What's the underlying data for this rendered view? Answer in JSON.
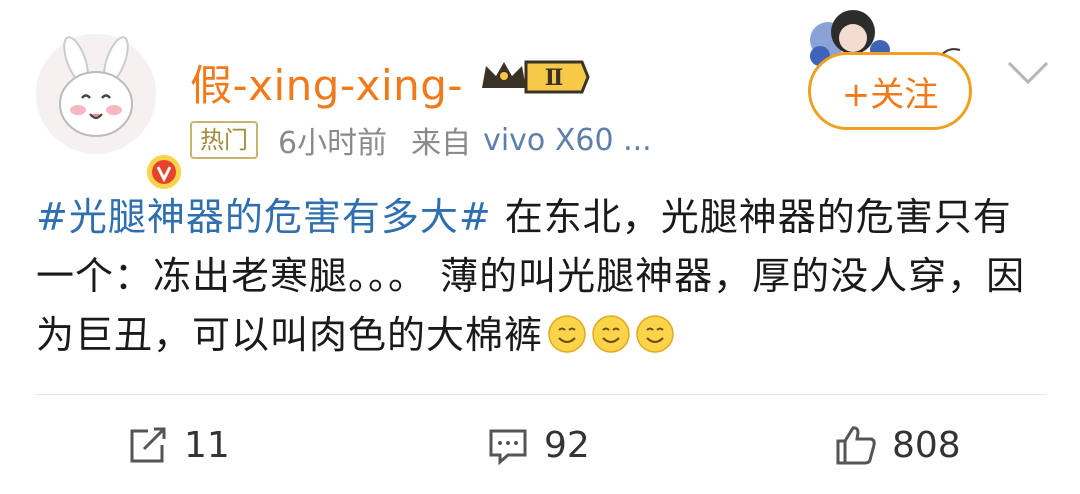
{
  "user": {
    "name": "假-xing-xing-",
    "rank_label": "Ⅱ",
    "follow_label": "+关注",
    "avatar_icon": "bunny-avatar-icon",
    "verified_icon": "verified-v-badge-icon"
  },
  "meta": {
    "hot_tag": "热门",
    "time": "6小时前",
    "source_prefix": "来自",
    "source": "vivo X60 ..."
  },
  "post": {
    "hashtag": "#光腿神器的危害有多大#",
    "body": " 在东北，光腿神器的危害只有一个：冻出老寒腿。。。 薄的叫光腿神器，厚的没人穿，因为巨丑，可以叫肉色的大棉裤",
    "emojis": [
      "smile-emoji",
      "smile-emoji",
      "smile-emoji"
    ]
  },
  "actions": {
    "repost_count": "11",
    "comment_count": "92",
    "like_count": "808"
  },
  "colors": {
    "username": "#f07a1c",
    "hashtag": "#2f6fb0",
    "follow_border": "#f0a020",
    "source_link": "#5d7fa8"
  }
}
